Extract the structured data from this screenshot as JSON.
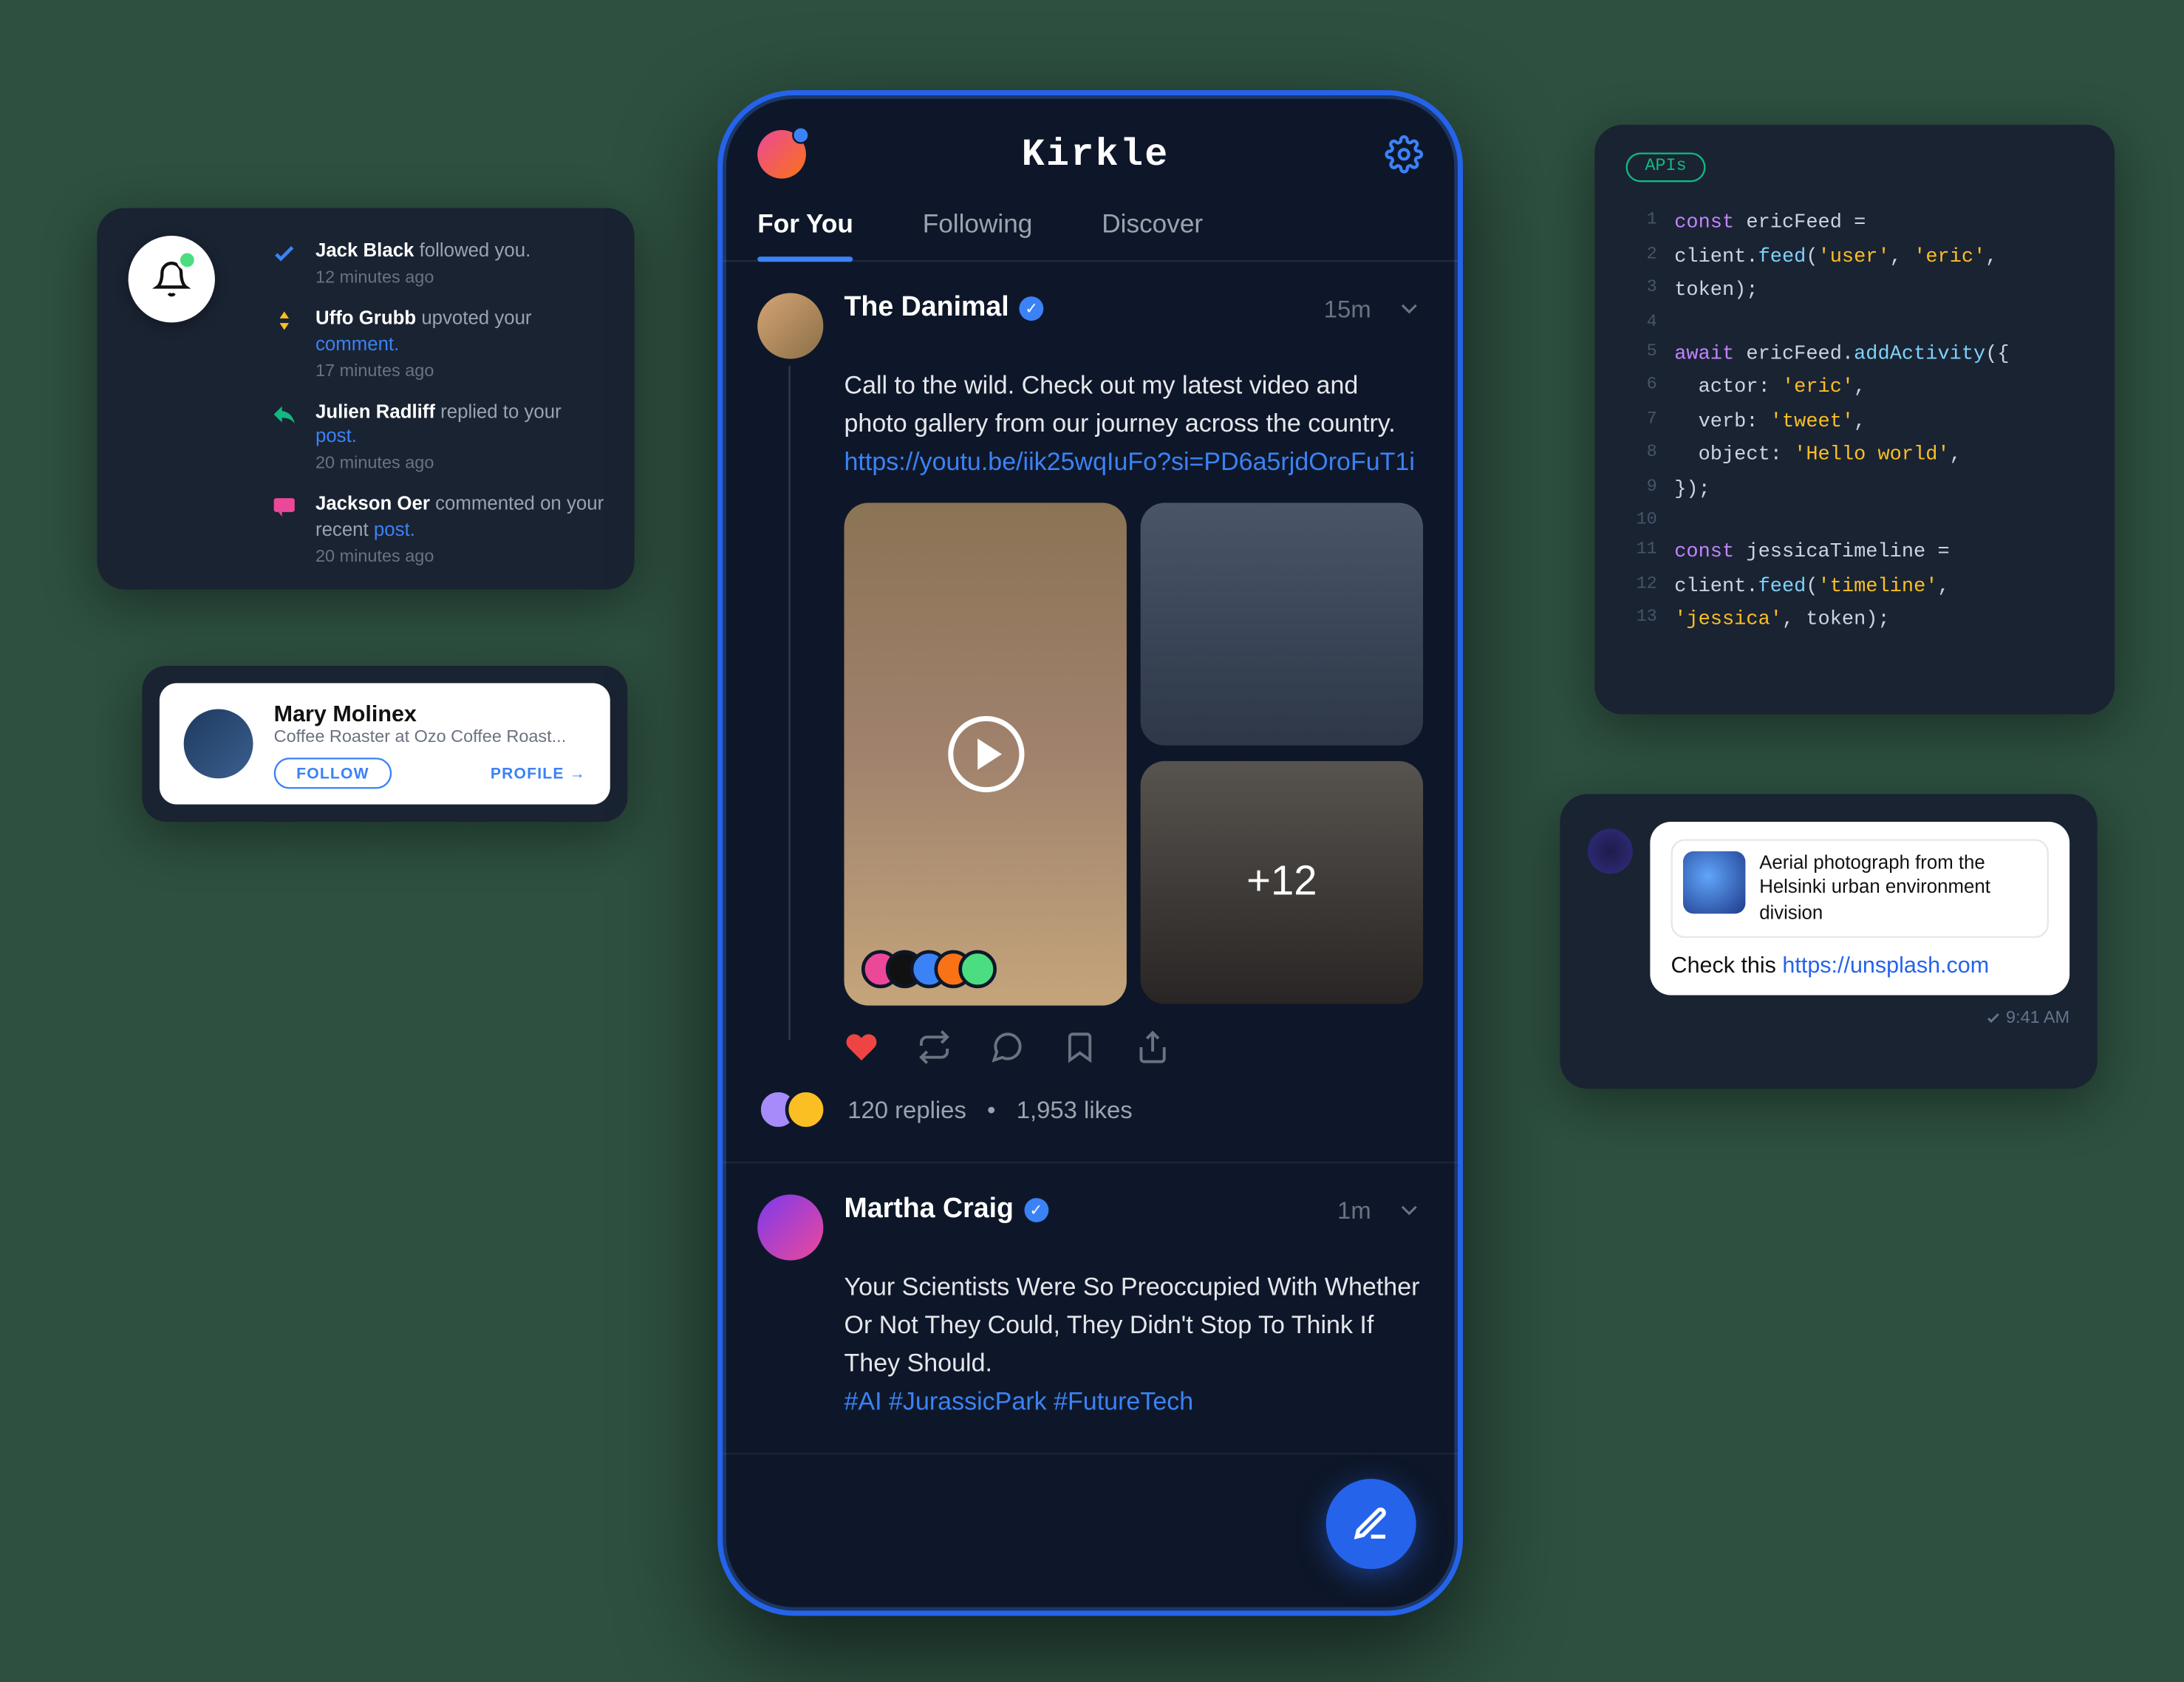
{
  "notifications": {
    "items": [
      {
        "name": "Jack Black",
        "action": " followed you.",
        "link": "",
        "time": "12 minutes ago",
        "icon": "check"
      },
      {
        "name": "Uffo Grubb",
        "action": " upvoted your ",
        "link": "comment.",
        "time": "17 minutes ago",
        "icon": "updown"
      },
      {
        "name": "Julien Radliff",
        "action": " replied to your ",
        "link": "post.",
        "time": "20 minutes ago",
        "icon": "reply"
      },
      {
        "name": "Jackson Oer",
        "action": " commented on your recent ",
        "link": "post.",
        "time": "20 minutes ago",
        "icon": "comment"
      }
    ]
  },
  "profile": {
    "name": "Mary Molinex",
    "subtitle": "Coffee Roaster at Ozo Coffee Roast...",
    "follow": "FOLLOW",
    "profile_link": "PROFILE →"
  },
  "phone": {
    "title": "Kirkle",
    "tabs": [
      "For You",
      "Following",
      "Discover"
    ],
    "posts": [
      {
        "author": "The Danimal",
        "time": "15m",
        "body": "Call to the wild. Check out my latest video and photo gallery from our journey across the country.",
        "url": "https://youtu.be/iik25wqIuFo?si=PD6a5rjdOroFuT1i",
        "more_count": "+12",
        "replies": "120 replies",
        "likes": "1,953 likes"
      },
      {
        "author": "Martha Craig",
        "time": "1m",
        "body": "Your Scientists Were So Preoccupied With Whether Or Not They Could, They Didn't Stop To Think If They Should.",
        "tags": "#AI #JurassicPark #FutureTech"
      }
    ]
  },
  "code": {
    "badge": "APIs",
    "lines": [
      {
        "n": "1",
        "html": "<span class='kw'>const</span> ericFeed ="
      },
      {
        "n": "2",
        "html": "client.<span class='fn'>feed</span>(<span class='str'>'user'</span>, <span class='str'>'eric'</span>,"
      },
      {
        "n": "3",
        "html": "token);"
      },
      {
        "n": "4",
        "html": ""
      },
      {
        "n": "5",
        "html": "<span class='kw'>await</span> ericFeed.<span class='fn'>addActivity</span>({"
      },
      {
        "n": "6",
        "html": "  actor: <span class='str'>'eric'</span>,"
      },
      {
        "n": "7",
        "html": "  verb: <span class='str'>'tweet'</span>,"
      },
      {
        "n": "8",
        "html": "  object: <span class='str'>'Hello world'</span>,"
      },
      {
        "n": "9",
        "html": "});"
      },
      {
        "n": "10",
        "html": ""
      },
      {
        "n": "11",
        "html": "<span class='kw'>const</span> jessicaTimeline ="
      },
      {
        "n": "12",
        "html": "client.<span class='fn'>feed</span>(<span class='str'>'timeline'</span>,"
      },
      {
        "n": "13",
        "html": "<span class='str'>'jessica'</span>, token);"
      }
    ]
  },
  "message": {
    "preview": "Aerial photograph from the Helsinki urban environment division",
    "body_text": "Check this  ",
    "body_url": "https://unsplash.com",
    "time": "9:41 AM"
  }
}
